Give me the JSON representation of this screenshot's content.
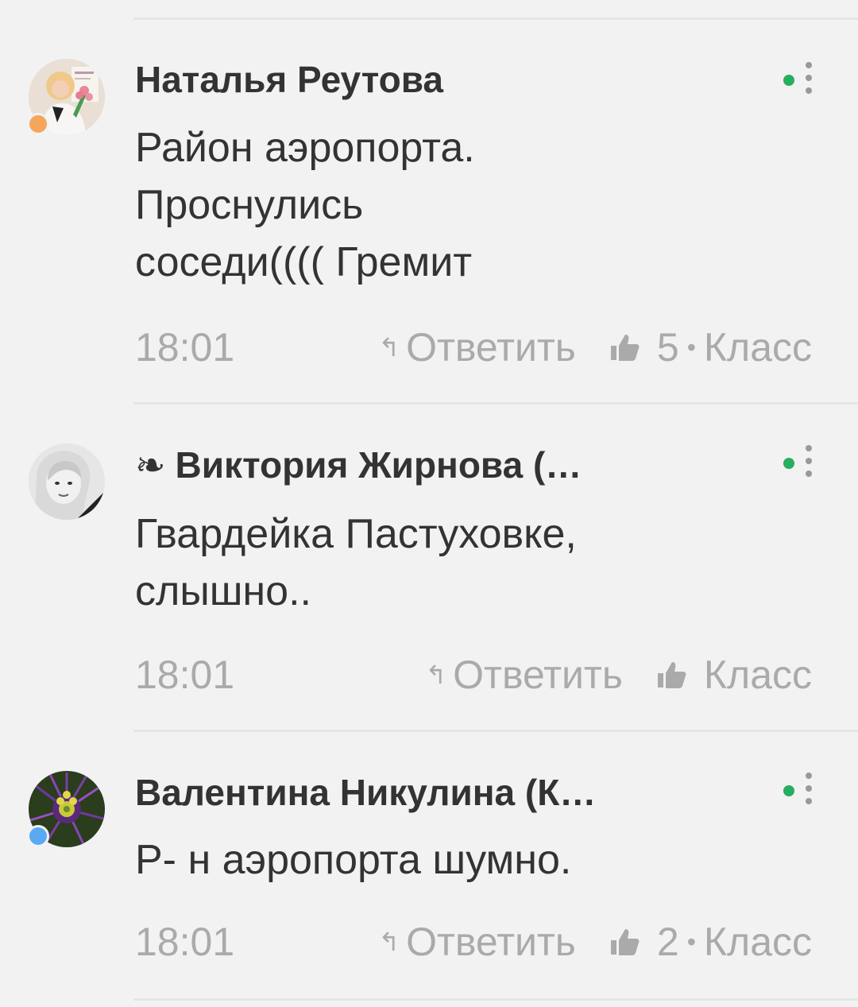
{
  "comments": [
    {
      "author": "Наталья Реутова",
      "ornament": "",
      "text_lines": [
        "Район аэропорта.",
        "Проснулись",
        "соседи(((( Гремит"
      ],
      "time": "18:01",
      "reply_label": "Ответить",
      "likes": "5",
      "like_label": "Класс",
      "status_color": "#f5a65b",
      "avatar_icon": "avatar-woman-with-flowers"
    },
    {
      "author": "Виктория Жирнова (…",
      "ornament": "❧",
      "text_lines": [
        "Гвардейка Пастуховке,",
        "слышно.."
      ],
      "time": "18:01",
      "reply_label": "Ответить",
      "likes": "",
      "like_label": "Класс",
      "status_color": "",
      "avatar_icon": "avatar-bw-portrait"
    },
    {
      "author": "Валентина Никулина (К…",
      "ornament": "",
      "text_lines": [
        "Р- н аэропорта шумно."
      ],
      "time": "18:01",
      "reply_label": "Ответить",
      "likes": "2",
      "like_label": "Класс",
      "status_color": "#5aa9f5",
      "avatar_icon": "avatar-passion-flower"
    }
  ],
  "colors": {
    "background": "#f2f2f2",
    "text": "#333333",
    "muted": "#aaaaaa",
    "online": "#27ae60"
  }
}
